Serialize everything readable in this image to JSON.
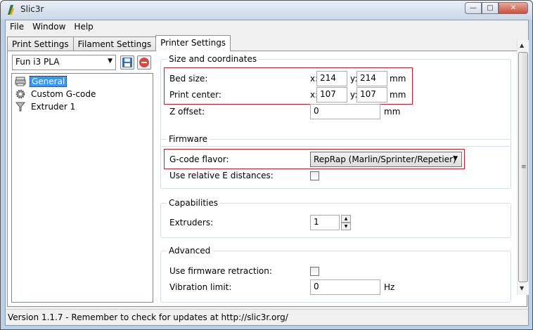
{
  "window": {
    "title": "Slic3r",
    "controls": {
      "minimize": "—",
      "maximize": "□",
      "close": "✕"
    }
  },
  "menu": [
    "File",
    "Window",
    "Help"
  ],
  "tabs": [
    {
      "label": "Print Settings",
      "active": false
    },
    {
      "label": "Filament Settings",
      "active": false
    },
    {
      "label": "Printer Settings",
      "active": true
    }
  ],
  "preset": {
    "selected": "Fun i3 PLA",
    "save_icon": "save-icon",
    "delete_icon": "delete-icon"
  },
  "tree": [
    {
      "label": "General",
      "icon": "printer-icon",
      "selected": true
    },
    {
      "label": "Custom G-code",
      "icon": "gear-icon",
      "selected": false
    },
    {
      "label": "Extruder 1",
      "icon": "funnel-icon",
      "selected": false
    }
  ],
  "size": {
    "title": "Size and coordinates",
    "bed_label": "Bed size:",
    "bed_x_prefix": "x:",
    "bed_x": "214",
    "bed_y_prefix": "y:",
    "bed_y": "214",
    "bed_unit": "mm",
    "center_label": "Print center:",
    "center_x_prefix": "x:",
    "center_x": "107",
    "center_y_prefix": "y:",
    "center_y": "107",
    "center_unit": "mm",
    "zoffset_label": "Z offset:",
    "zoffset": "0",
    "zoffset_unit": "mm"
  },
  "firmware": {
    "title": "Firmware",
    "flavor_label": "G-code flavor:",
    "flavor": "RepRap (Marlin/Sprinter/Repetier)",
    "relative_label": "Use relative E distances:",
    "relative_checked": false
  },
  "capabilities": {
    "title": "Capabilities",
    "extruders_label": "Extruders:",
    "extruders": "1"
  },
  "advanced": {
    "title": "Advanced",
    "retraction_label": "Use firmware retraction:",
    "retraction_checked": false,
    "vibration_label": "Vibration limit:",
    "vibration": "0",
    "vibration_unit": "Hz"
  },
  "status": "Version 1.1.7 - Remember to check for updates at http://slic3r.org/",
  "colors": {
    "highlight": "#c0212b",
    "selection": "#3399ff"
  }
}
